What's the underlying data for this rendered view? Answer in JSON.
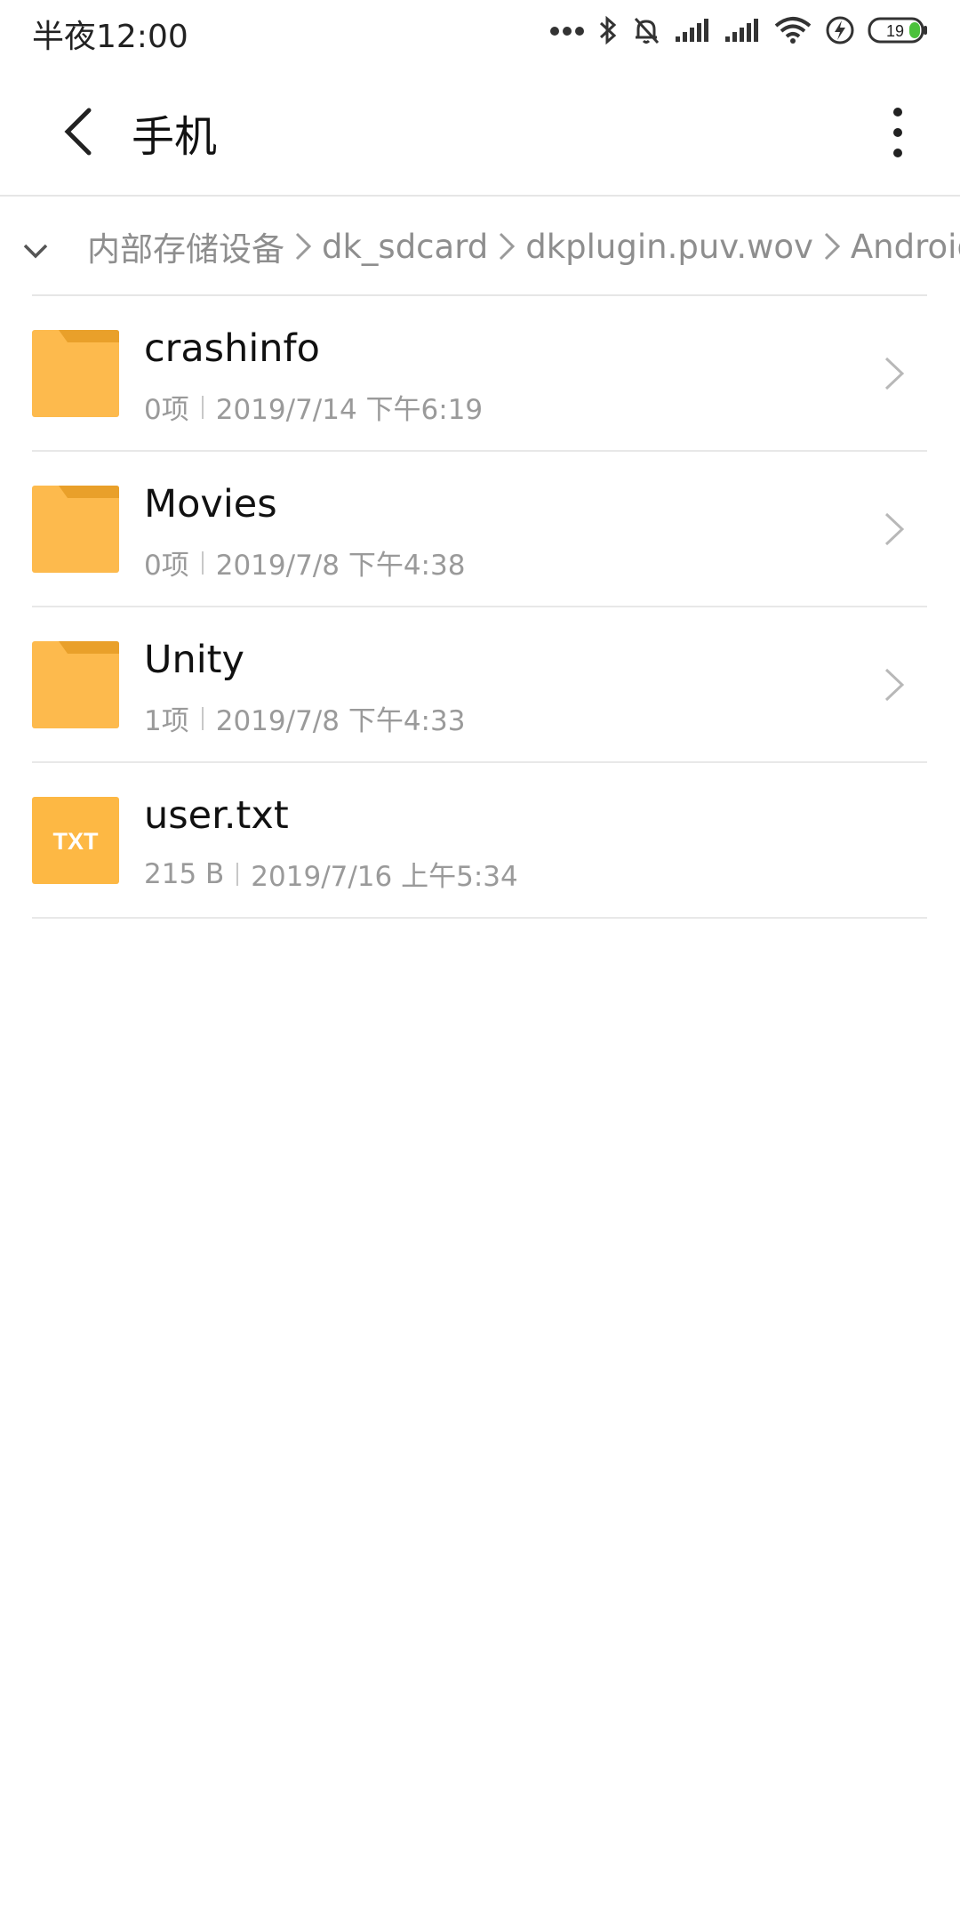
{
  "status_bar": {
    "time": "半夜12:00",
    "battery_level": "19",
    "icons": [
      "more-dots-icon",
      "bluetooth-icon",
      "bell-mute-icon",
      "signal-icon",
      "signal-icon",
      "wifi-icon",
      "charging-icon",
      "battery-icon"
    ]
  },
  "app_bar": {
    "title": "手机",
    "back_icon": "back-arrow-icon",
    "more_icon": "more-vert-icon"
  },
  "breadcrumb": {
    "items": [
      "内部存储设备",
      "dk_sdcard",
      "dkplugin.puv.wov",
      "Android"
    ]
  },
  "files": [
    {
      "name": "crashinfo",
      "type": "folder",
      "count": "0项",
      "date": "2019/7/14 下午6:19"
    },
    {
      "name": "Movies",
      "type": "folder",
      "count": "0项",
      "date": "2019/7/8 下午4:38"
    },
    {
      "name": "Unity",
      "type": "folder",
      "count": "1项",
      "date": "2019/7/8 下午4:33"
    },
    {
      "name": "user.txt",
      "type": "txt",
      "icon_label": "TXT",
      "count": "215 B",
      "date": "2019/7/16 上午5:34"
    }
  ],
  "colors": {
    "folder": "#FDBA4D",
    "folder_tab": "#E9A02A",
    "txt_icon": "#FDB844",
    "battery_fill": "#4CC13C",
    "meta_text": "#9a9a9a"
  }
}
